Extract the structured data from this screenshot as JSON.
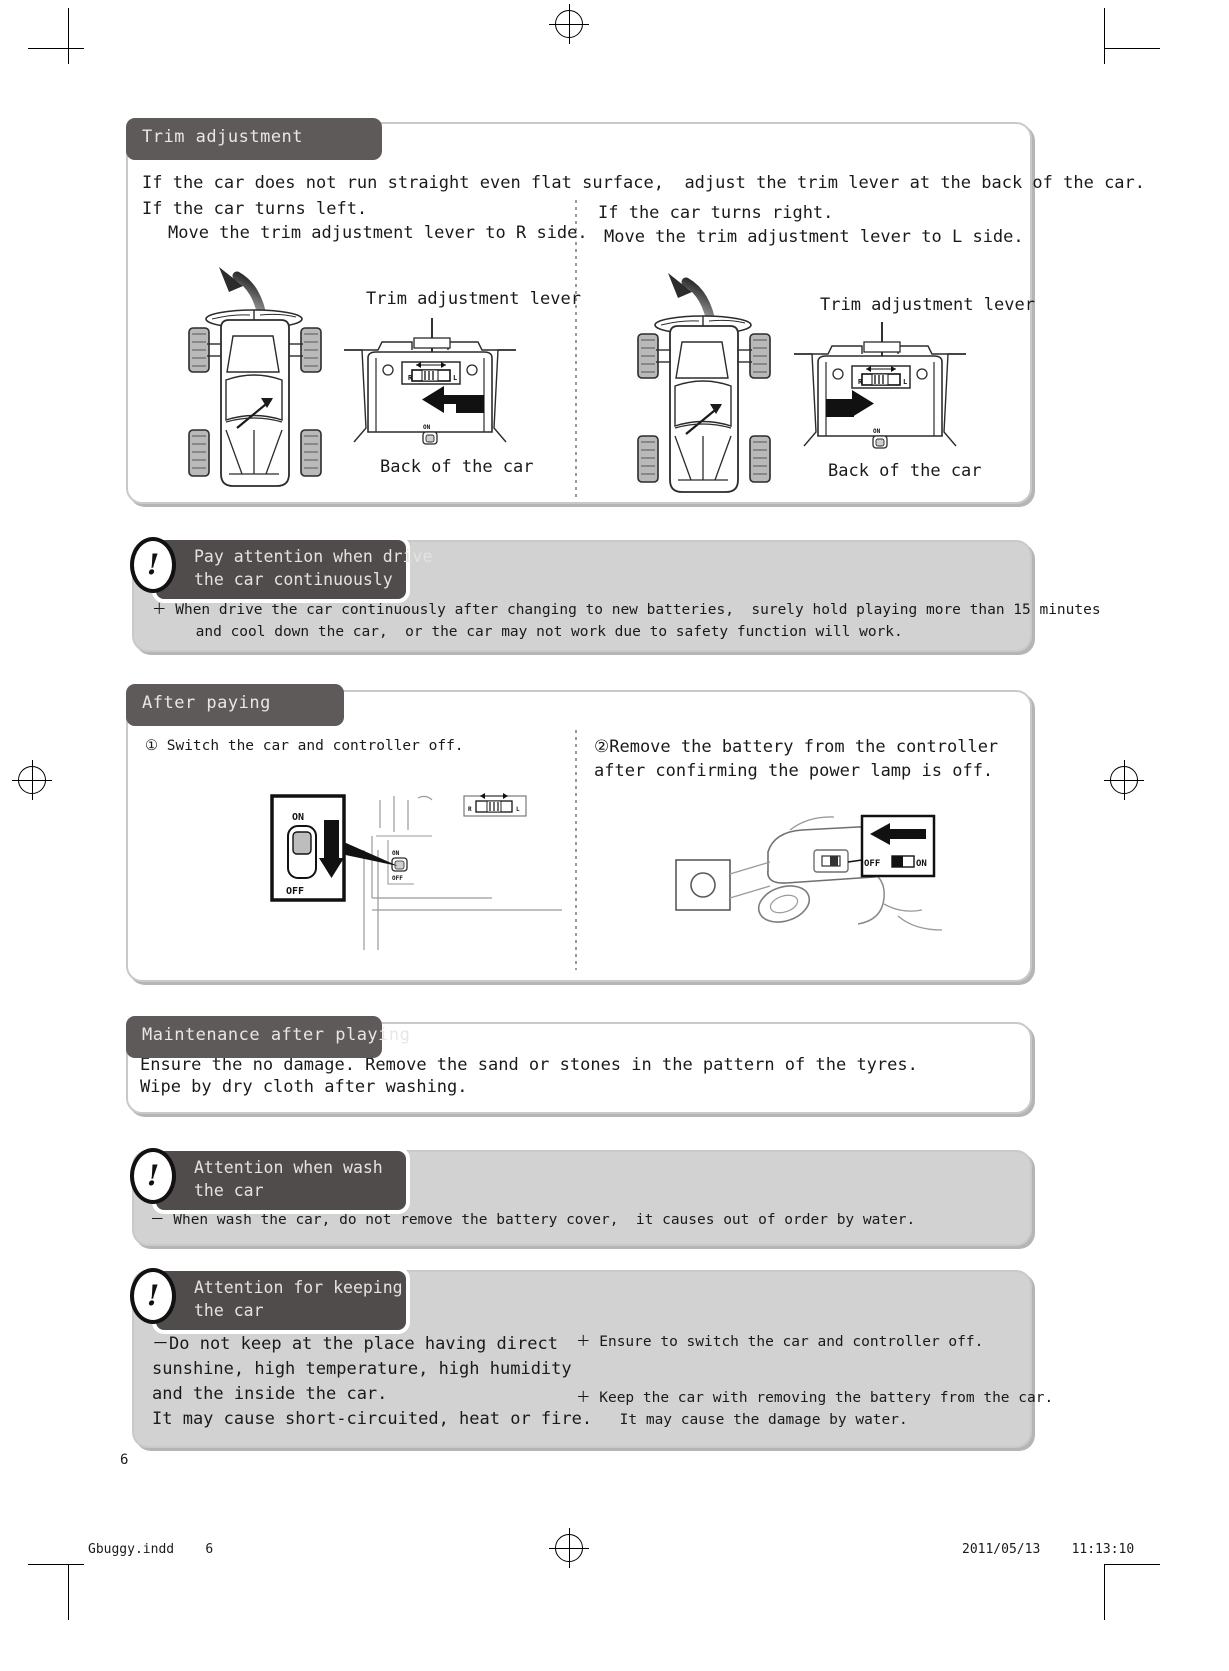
{
  "page": {
    "number": "6",
    "footer_file": "Gbuggy.indd    6",
    "footer_timestamp": "2011/05/13    11:13:10"
  },
  "trim_section": {
    "header": "Trim adjustment",
    "intro": "If the car does not run straight even flat surface,  adjust the trim lever at the back of the car.",
    "left": {
      "condition": "If the car turns left.",
      "instruction": "Move the trim adjustment lever to R side.",
      "lever_caption": "Trim adjustment lever",
      "back_caption": "Back of the car",
      "lever_left_mark": "R",
      "lever_right_mark": "L",
      "switch_on_mark": "ON",
      "arrow_direction": "left"
    },
    "right": {
      "condition": "If the car turns right.",
      "instruction": "Move the trim adjustment lever to L side.",
      "lever_caption": "Trim adjustment lever",
      "back_caption": "Back of the car",
      "lever_left_mark": "R",
      "lever_right_mark": "L",
      "switch_on_mark": "ON",
      "arrow_direction": "right"
    }
  },
  "warn_continuous": {
    "label": "Pay attention when drive\nthe car continuously",
    "badge": "!",
    "body_line1": "＋ When drive the car continuously after changing to new batteries,  surely hold playing more than 15 minutes",
    "body_line2": "     and cool down the car,  or the car may not work due to safety function will work."
  },
  "after_paying": {
    "header": "After paying",
    "step1": "① Switch the car and controller off.",
    "step2_line1": "②Remove the battery from the controller",
    "step2_line2": "after confirming the power lamp is off.",
    "switch_on": "ON",
    "switch_off": "OFF",
    "car_switch_on": "ON",
    "car_switch_off": "OFF",
    "controller_off": "OFF",
    "controller_on": "ON",
    "lever_left_mark": "R",
    "lever_right_mark": "L"
  },
  "maintenance": {
    "header": "Maintenance after playing",
    "line1": "Ensure the no damage. Remove the sand or stones in the pattern of the tyres.",
    "line2": "Wipe by dry cloth after washing."
  },
  "warn_wash": {
    "label": "Attention when wash\nthe car",
    "badge": "!",
    "body": "－ When wash the car, do not remove the battery cover,  it causes out of order by water."
  },
  "warn_keep": {
    "label": "Attention for keeping\nthe car",
    "badge": "!",
    "left_body": "－Do not keep at the place having direct\nsunshine, high temperature, high humidity\nand the inside the car.\nIt may cause short-circuited, heat or fire.",
    "right_body1": "＋ Ensure to switch the car and controller off.",
    "right_body2": "＋ Keep the car with removing the battery from the car.\n     It may cause the damage by water."
  },
  "colors": {
    "tab_dark": "#5e5a59",
    "warn_label_dark": "#504c4b",
    "panel_border": "#c9c9c9",
    "panel_grey": "#d2d2d2",
    "shadow": "#b5b5b5"
  }
}
